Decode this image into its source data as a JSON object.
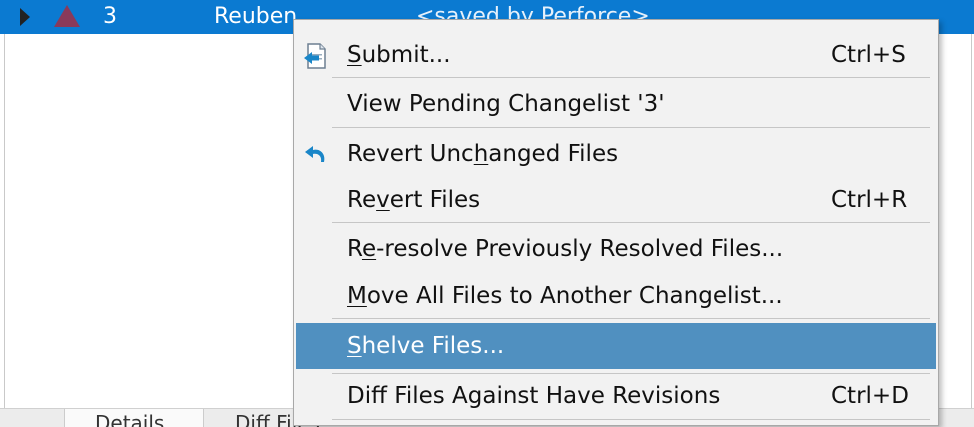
{
  "changelist_row": {
    "number": "3",
    "user": "Reuben",
    "description": "<saved by Perforce>"
  },
  "bottom_tabs": [
    {
      "label": "Details"
    },
    {
      "label": "Diff Files"
    }
  ],
  "context_menu": {
    "items": [
      {
        "pre": "",
        "mn": "S",
        "post": "ubmit...",
        "shortcut": "Ctrl+S",
        "icon": "submit-icon"
      },
      {
        "pre": "View Pending Changelist '3'",
        "mn": "",
        "post": "",
        "shortcut": ""
      },
      {
        "pre": "Revert Unc",
        "mn": "h",
        "post": "anged Files",
        "shortcut": "",
        "icon": "revert-arrow-icon"
      },
      {
        "pre": "Re",
        "mn": "v",
        "post": "ert Files",
        "shortcut": "Ctrl+R"
      },
      {
        "pre": "R",
        "mn": "e",
        "post": "-resolve Previously Resolved Files...",
        "shortcut": ""
      },
      {
        "pre": "",
        "mn": "M",
        "post": "ove All Files to Another Changelist...",
        "shortcut": ""
      },
      {
        "pre": "",
        "mn": "S",
        "post": "helve Files...",
        "shortcut": "",
        "highlighted": true
      },
      {
        "pre": "Diff Files Against Have Revisions",
        "mn": "",
        "post": "",
        "shortcut": "Ctrl+D"
      }
    ]
  },
  "colors": {
    "selection_row": "#0b7ad1",
    "menu_highlight": "#5090c0",
    "menu_background": "#f2f2f2",
    "pending_icon": "#8a3a5a"
  }
}
